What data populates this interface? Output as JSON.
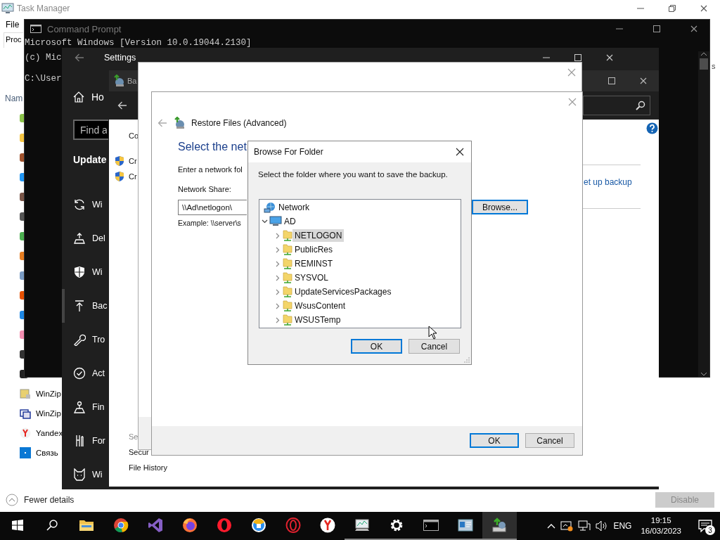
{
  "task_manager": {
    "title": "Task Manager",
    "menu": [
      "File"
    ],
    "tabs": [
      {
        "label": "Proc",
        "selected": true
      }
    ],
    "column": "Nam",
    "column_2": "s",
    "rows": [
      {
        "name": "WinZip",
        "kind": "winzip"
      },
      {
        "name": "WinZip",
        "kind": "winzip2"
      },
      {
        "name": "Yandex",
        "kind": "yandex"
      },
      {
        "name": "Связь",
        "kind": "tile"
      }
    ],
    "fewer_details": "Fewer details",
    "disable_button": {
      "label": "Disable",
      "disabled": true
    }
  },
  "command_prompt": {
    "title": "Command Prompt",
    "lines": [
      "Microsoft Windows [Version 10.0.19044.2130]",
      "(c) Mic",
      "C:\\User"
    ]
  },
  "settings": {
    "title": "Settings",
    "home": "Ho",
    "search": {
      "placeholder": "Find a"
    },
    "section": "Update",
    "items": [
      {
        "label": "Wi",
        "kind": "sync",
        "selected": false
      },
      {
        "label": "Del",
        "kind": "delivery",
        "selected": false
      },
      {
        "label": "Wi",
        "kind": "shield",
        "selected": false
      },
      {
        "label": "Bac",
        "kind": "backup",
        "selected": true
      },
      {
        "label": "Tro",
        "kind": "wrench",
        "selected": false
      },
      {
        "label": "Act",
        "kind": "check",
        "selected": false
      },
      {
        "label": "Fin",
        "kind": "person",
        "selected": false
      },
      {
        "label": "For",
        "kind": "tools",
        "selected": false
      },
      {
        "label": "Wi",
        "kind": "cat",
        "selected": false
      }
    ]
  },
  "backup_panel": {
    "title": "Ba",
    "nav_top": "Co",
    "tasks": [
      "Cr",
      "Cr"
    ],
    "see_also": "Se",
    "links": [
      "Secur",
      "File History"
    ],
    "setup_link": "et up backup"
  },
  "restore_wizard": {
    "title": "Restore Files (Advanced)",
    "heading": "Select the net",
    "intro": "Enter a network fol",
    "share_label": "Network Share:",
    "share_value": "\\\\Ad\\netlogon\\",
    "example": "Example: \\\\server\\s",
    "browse_button": {
      "label": "Browse...",
      "default": true
    },
    "buttons": [
      {
        "label": "OK",
        "default": true
      },
      {
        "label": "Cancel",
        "default": false
      }
    ]
  },
  "browse_dialog": {
    "title": "Browse For Folder",
    "instruction": "Select the folder where you want to save the backup.",
    "tree": [
      {
        "label": "Network",
        "kind": "network",
        "selected": false,
        "children": [
          {
            "label": "AD",
            "kind": "computer",
            "expanded": true,
            "selected": false,
            "children": [
              {
                "label": "NETLOGON",
                "kind": "share",
                "expanded": false,
                "selected": true
              },
              {
                "label": "PublicRes",
                "kind": "share",
                "expanded": false,
                "selected": false
              },
              {
                "label": "REMINST",
                "kind": "share",
                "expanded": false,
                "selected": false
              },
              {
                "label": "SYSVOL",
                "kind": "share",
                "expanded": false,
                "selected": false
              },
              {
                "label": "UpdateServicesPackages",
                "kind": "share",
                "expanded": false,
                "selected": false
              },
              {
                "label": "WsusContent",
                "kind": "share",
                "expanded": false,
                "selected": false
              },
              {
                "label": "WSUSTemp",
                "kind": "share",
                "expanded": false,
                "selected": false
              }
            ]
          }
        ]
      }
    ],
    "buttons": [
      {
        "label": "OK",
        "default": true
      },
      {
        "label": "Cancel",
        "default": false
      }
    ]
  },
  "taskbar": {
    "apps": [
      {
        "kind": "start",
        "running": false,
        "active": false
      },
      {
        "kind": "search",
        "running": false,
        "active": false
      },
      {
        "kind": "explorer",
        "running": false,
        "active": false
      },
      {
        "kind": "chrome",
        "running": false,
        "active": false
      },
      {
        "kind": "vs",
        "running": false,
        "active": false
      },
      {
        "kind": "firefox",
        "running": false,
        "active": false
      },
      {
        "kind": "opera",
        "running": false,
        "active": false
      },
      {
        "kind": "shieldbrowser",
        "running": false,
        "active": false
      },
      {
        "kind": "operaring",
        "running": false,
        "active": false
      },
      {
        "kind": "yandex",
        "running": false,
        "active": false
      },
      {
        "kind": "taskmgr",
        "running": true,
        "active": false
      },
      {
        "kind": "gear",
        "running": true,
        "active": false
      },
      {
        "kind": "cmd",
        "running": true,
        "active": false
      },
      {
        "kind": "panel",
        "running": true,
        "active": false
      },
      {
        "kind": "backup",
        "running": true,
        "active": true
      }
    ],
    "language": "ENG",
    "time": "19:15",
    "date": "16/03/2023",
    "notifications": "3"
  }
}
